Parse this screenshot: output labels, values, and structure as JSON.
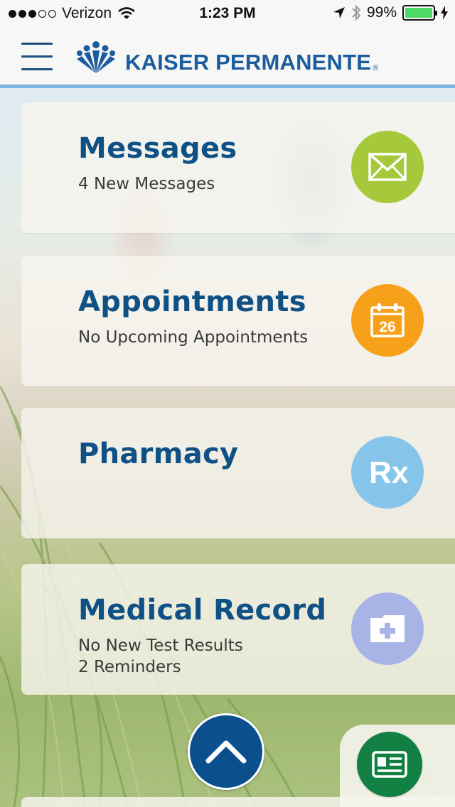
{
  "status_bar": {
    "carrier": "Verizon",
    "time": "1:23 PM",
    "battery_percent": "99%",
    "signal_bars": 3,
    "signal_total": 5,
    "icons": [
      "wifi-icon",
      "location-arrow-icon",
      "bluetooth-icon",
      "battery-icon",
      "charging-icon"
    ]
  },
  "header": {
    "brand": "KAISER PERMANENTE",
    "brand_mark": "®",
    "menu_icon": "hamburger-menu-icon",
    "accent_color": "#7fb7df",
    "brand_color": "#1b5c9e"
  },
  "cards": [
    {
      "title": "Messages",
      "lines": [
        "4 New Messages"
      ],
      "icon": "envelope-icon",
      "color": "#a5c93a"
    },
    {
      "title": "Appointments",
      "lines": [
        "No Upcoming Appointments"
      ],
      "icon": "calendar-icon",
      "icon_text": "26",
      "color": "#f7a11a"
    },
    {
      "title": "Pharmacy",
      "lines": [],
      "icon": "rx-icon",
      "icon_text": "Rx",
      "color": "#86c4ea"
    },
    {
      "title": "Medical Record",
      "lines": [
        "No New Test Results",
        "2 Reminders"
      ],
      "icon": "medical-folder-icon",
      "color": "#a8b3e6"
    }
  ],
  "bottom": {
    "up_button_icon": "chevron-up-icon",
    "up_button_color": "#0b4f8c",
    "id_card_icon": "id-card-icon",
    "id_card_color": "#138043"
  }
}
